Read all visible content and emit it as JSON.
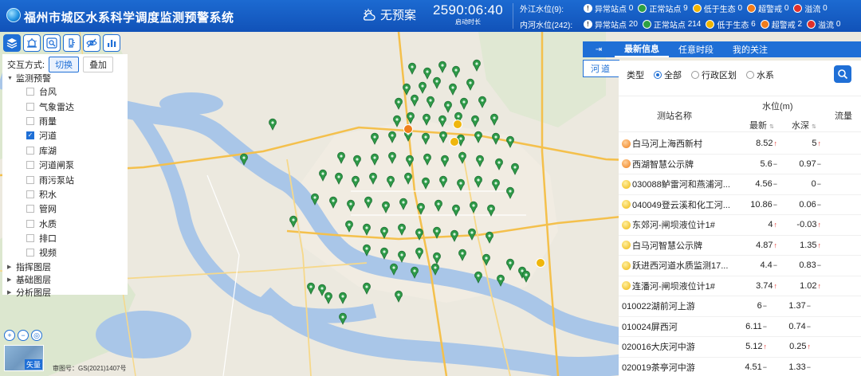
{
  "header": {
    "title": "福州市城区水系科学调度监测预警系统",
    "weather_text": "无预案",
    "runtime_value": "2590:06:40",
    "runtime_label": "启动时长"
  },
  "outer_status": {
    "label": "外江水位(9):",
    "items": [
      {
        "icon": "abnormal",
        "label": "异常站点",
        "count": "0"
      },
      {
        "icon": "normal",
        "label": "正常站点",
        "count": "9"
      },
      {
        "icon": "eco",
        "label": "低于生态",
        "count": "0"
      },
      {
        "icon": "warn",
        "label": "超警戒",
        "count": "0"
      },
      {
        "icon": "overflow",
        "label": "溢流",
        "count": "0"
      }
    ]
  },
  "inner_status": {
    "label": "内河水位(242):",
    "items": [
      {
        "icon": "abnormal",
        "label": "异常站点",
        "count": "20"
      },
      {
        "icon": "normal",
        "label": "正常站点",
        "count": "214"
      },
      {
        "icon": "eco",
        "label": "低于生态",
        "count": "6"
      },
      {
        "icon": "warn",
        "label": "超警戒",
        "count": "2"
      },
      {
        "icon": "overflow",
        "label": "溢流",
        "count": "0"
      }
    ]
  },
  "left_panel": {
    "mode_label": "交互方式:",
    "mode_switch": "切换",
    "mode_overlay": "叠加",
    "group_monitor": "监测预警",
    "layers": [
      {
        "label": "台风",
        "checked": false
      },
      {
        "label": "气象雷达",
        "checked": false
      },
      {
        "label": "雨量",
        "checked": false
      },
      {
        "label": "河道",
        "checked": true
      },
      {
        "label": "库湖",
        "checked": false
      },
      {
        "label": "河道闸泵",
        "checked": false
      },
      {
        "label": "雨污泵站",
        "checked": false
      },
      {
        "label": "积水",
        "checked": false
      },
      {
        "label": "管网",
        "checked": false
      },
      {
        "label": "水质",
        "checked": false
      },
      {
        "label": "排口",
        "checked": false
      },
      {
        "label": "视频",
        "checked": false
      }
    ],
    "group_indicator": "指挥图层",
    "group_base": "基础图层",
    "group_analysis": "分析图层"
  },
  "map": {
    "credit": "审图号：GS(2021)1407号",
    "basemap_label": "矢量"
  },
  "right_panel": {
    "river_tab": "河道",
    "tabs": [
      "最新信息",
      "任意时段",
      "我的关注"
    ],
    "filter_label": "类型",
    "filter_options": [
      "全部",
      "行政区划",
      "水系"
    ],
    "col_name": "测站名称",
    "col_level": "水位(m)",
    "col_latest": "最新",
    "col_depth": "水深",
    "col_flow": "流量",
    "rows": [
      {
        "icon": "orange",
        "name": "白马河上海西新村",
        "latest": "8.52",
        "la": "up",
        "depth": "5",
        "da": "up"
      },
      {
        "icon": "orange",
        "name": "西湖智慧公示牌",
        "latest": "5.6",
        "la": "flat",
        "depth": "0.97",
        "da": "flat"
      },
      {
        "icon": "yellow",
        "name": "030088鲈雷河和燕浦河...",
        "latest": "4.56",
        "la": "flat",
        "depth": "0",
        "da": "flat"
      },
      {
        "icon": "yellow",
        "name": "040049登云溪和化工河...",
        "latest": "10.86",
        "la": "flat",
        "depth": "0.06",
        "da": "flat"
      },
      {
        "icon": "yellow",
        "name": "东郊河-闸坝液位计1#",
        "latest": "4",
        "la": "up",
        "depth": "-0.03",
        "da": "up"
      },
      {
        "icon": "yellow",
        "name": "白马河智慧公示牌",
        "latest": "4.87",
        "la": "up",
        "depth": "1.35",
        "da": "up"
      },
      {
        "icon": "yellow",
        "name": "跃进西河道水质监测17...",
        "latest": "4.4",
        "la": "flat",
        "depth": "0.83",
        "da": "flat"
      },
      {
        "icon": "yellow",
        "name": "连潘河-闸坝液位计1#",
        "latest": "3.74",
        "la": "up",
        "depth": "1.02",
        "da": "up"
      },
      {
        "icon": "none",
        "name": "010022湖前河上游",
        "latest": "6",
        "la": "flat",
        "depth": "1.37",
        "da": "flat"
      },
      {
        "icon": "none",
        "name": "010024屏西河",
        "latest": "6.11",
        "la": "flat",
        "depth": "0.74",
        "da": "flat"
      },
      {
        "icon": "none",
        "name": "020016大庆河中游",
        "latest": "5.12",
        "la": "up",
        "depth": "0.25",
        "da": "up"
      },
      {
        "icon": "none",
        "name": "020019茶亭河中游",
        "latest": "4.51",
        "la": "flat",
        "depth": "1.33",
        "da": "flat"
      }
    ]
  }
}
